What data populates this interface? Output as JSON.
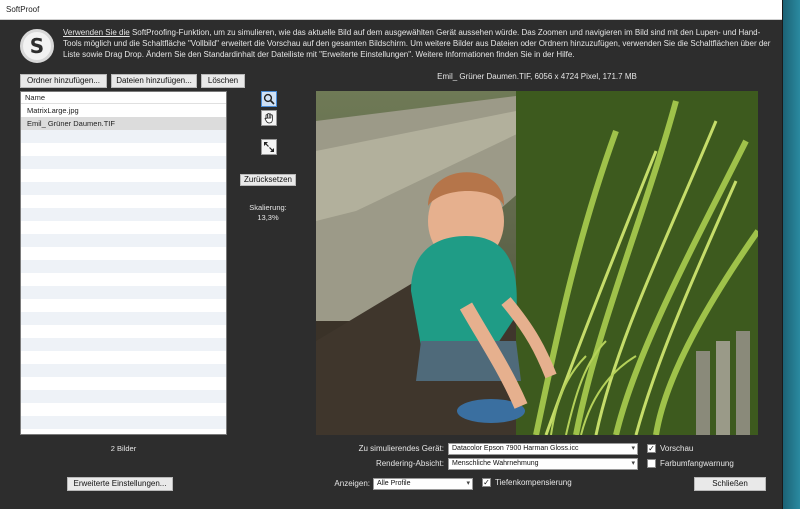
{
  "window": {
    "title": "SoftProof"
  },
  "intro": {
    "lead": "Verwenden Sie die",
    "text": " SoftProofing-Funktion, um zu simulieren, wie das aktuelle Bild auf dem ausgewählten Gerät aussehen würde. Das Zoomen und navigieren im Bild sind mit den Lupen- und Hand-Tools möglich und die Schaltfläche \"Vollbild\" erweitert die Vorschau auf den gesamten Bildschirm. Um weitere Bilder aus Dateien oder Ordnern hinzuzufügen, verwenden Sie die Schaltflächen über der Liste sowie Drag  Drop. Ändern Sie den Standardinhalt der Dateiliste mit \"Erweiterte Einstellungen\". Weitere Informationen finden Sie in der Hilfe."
  },
  "toolbar": {
    "add_folder": "Ordner hinzufügen...",
    "add_files": "Dateien hinzufügen...",
    "delete": "Löschen"
  },
  "filelist": {
    "header": "Name",
    "items": [
      {
        "name": "MatrixLarge.jpg",
        "selected": false
      },
      {
        "name": "Emil_ Grüner Daumen.TIF",
        "selected": true
      }
    ],
    "count": "2 Bilder"
  },
  "tools": {
    "zoom_icon": "magnifier-icon",
    "hand_icon": "hand-icon",
    "fullscreen_icon": "fullscreen-icon",
    "reset": "Zurücksetzen",
    "scale_label": "Skalierung:",
    "scale_value": "13,3%"
  },
  "preview": {
    "title": "Emil_ Grüner Daumen.TIF, 6056 x 4724 Pixel, 171.7 MB"
  },
  "settings": {
    "device_label": "Zu simulierendes Gerät:",
    "device_value": "Datacolor Epson 7900 Harman Gloss.icc",
    "intent_label": "Rendering-Absicht:",
    "intent_value": "Menschliche Wahrnehmung",
    "show_label": "Anzeigen:",
    "show_value": "Alle Profile",
    "preview_check": {
      "label": "Vorschau",
      "checked": true
    },
    "gamut_check": {
      "label": "Farbumfangwarnung",
      "checked": false
    },
    "depth_check": {
      "label": "Tiefenkompensierung",
      "checked": true
    }
  },
  "footer": {
    "advanced": "Erweiterte Einstellungen...",
    "close": "Schließen"
  },
  "colors": {
    "background": "#2d2d2d",
    "selection": "#dcdcdc",
    "accent": "#4a8cd6"
  }
}
